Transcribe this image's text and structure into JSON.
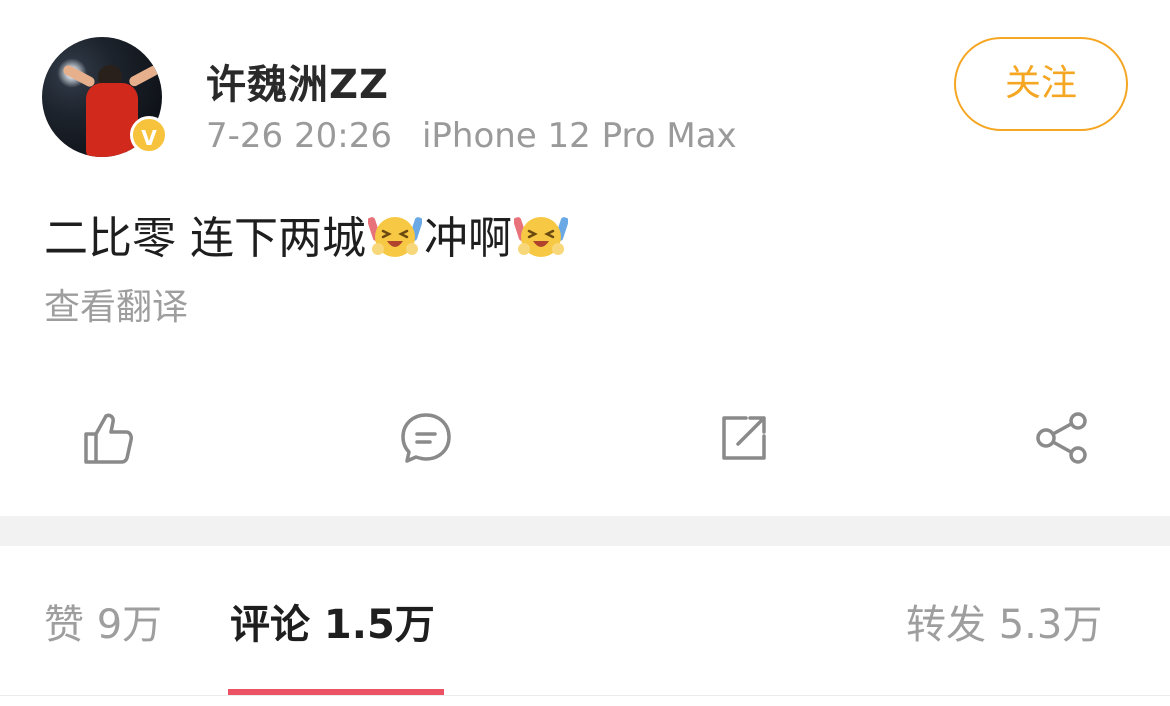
{
  "user": {
    "name": "许魏洲ZZ",
    "timestamp": "7-26 20:26",
    "device": "iPhone 12 Pro Max",
    "verified_badge": "V"
  },
  "follow_button": {
    "label": "关注",
    "color": "#f5a623"
  },
  "post": {
    "text_part1": "二比零 连下两城",
    "emoji_1": "squint-laugh-emoji",
    "text_part2": "冲啊",
    "emoji_2": "squint-laugh-emoji",
    "translate_link": "查看翻译"
  },
  "actions": [
    {
      "name": "like",
      "icon": "thumbs-up-icon"
    },
    {
      "name": "comment",
      "icon": "comment-icon"
    },
    {
      "name": "repost",
      "icon": "repost-icon"
    },
    {
      "name": "share",
      "icon": "share-icon"
    }
  ],
  "tabs": {
    "likes": "赞 9万",
    "comments": "评论 1.5万",
    "reposts": "转发 5.3万",
    "active": "comments",
    "active_color": "#eb5264"
  }
}
